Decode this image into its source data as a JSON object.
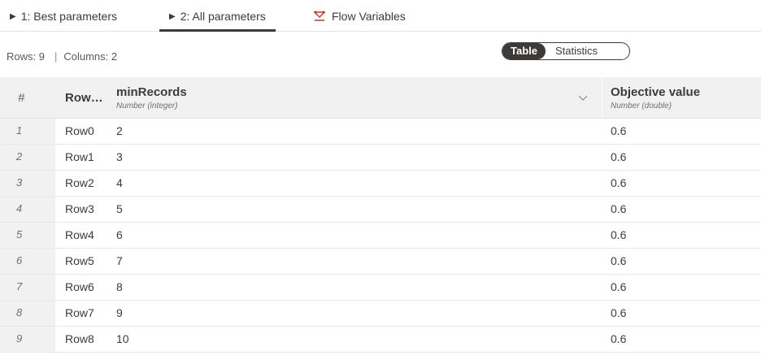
{
  "tabs": [
    {
      "label": "1: Best parameters"
    },
    {
      "label": "2: All parameters"
    },
    {
      "label": "Flow Variables"
    }
  ],
  "info": {
    "rows": "Rows: 9",
    "separator": "|",
    "columns": "Columns: 2"
  },
  "view_toggle": {
    "table": "Table",
    "statistics": "Statistics"
  },
  "table": {
    "hash_header": "#",
    "rowid_header": "Row…",
    "columns": [
      {
        "name": "minRecords",
        "type": "Number (integer)"
      },
      {
        "name": "Objective value",
        "type": "Number (double)"
      }
    ],
    "rows": [
      {
        "n": "1",
        "id": "Row0",
        "a": "2",
        "b": "0.6"
      },
      {
        "n": "2",
        "id": "Row1",
        "a": "3",
        "b": "0.6"
      },
      {
        "n": "3",
        "id": "Row2",
        "a": "4",
        "b": "0.6"
      },
      {
        "n": "4",
        "id": "Row3",
        "a": "5",
        "b": "0.6"
      },
      {
        "n": "5",
        "id": "Row4",
        "a": "6",
        "b": "0.6"
      },
      {
        "n": "6",
        "id": "Row5",
        "a": "7",
        "b": "0.6"
      },
      {
        "n": "7",
        "id": "Row6",
        "a": "8",
        "b": "0.6"
      },
      {
        "n": "8",
        "id": "Row7",
        "a": "9",
        "b": "0.6"
      },
      {
        "n": "9",
        "id": "Row8",
        "a": "10",
        "b": "0.6"
      }
    ]
  },
  "icons": {
    "tab_triangle": "play-triangle-icon",
    "flow": "flow-variable-icon",
    "sort": "chevron-down-icon"
  },
  "colors": {
    "text": "#3e3a39",
    "header_bg": "#f1f1f1",
    "accent": "#3e3a39"
  }
}
